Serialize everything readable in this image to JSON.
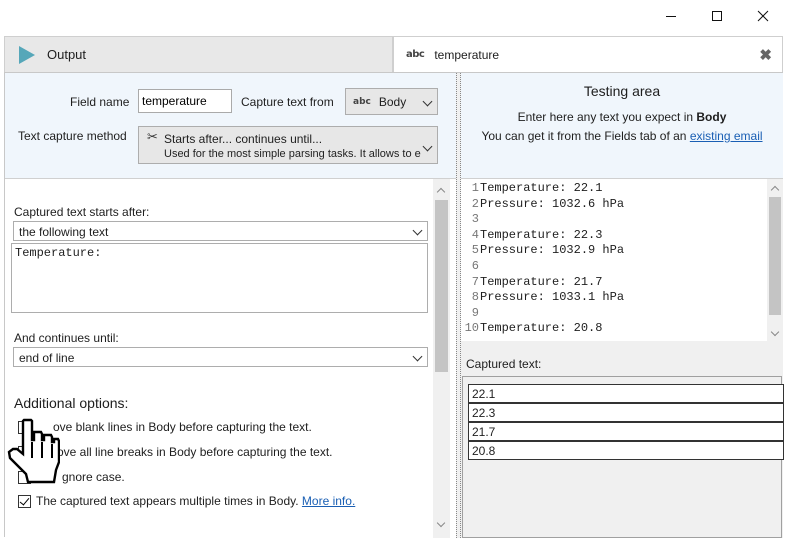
{
  "window": {
    "minimize_glyph": "—",
    "maximize_glyph": "☐",
    "close_glyph": "✕"
  },
  "tabs": [
    {
      "label": "Output",
      "icon": "play-icon"
    },
    {
      "label": "temperature",
      "icon": "abc-icon",
      "icon_text": "abc",
      "close_glyph": "✖"
    }
  ],
  "field_config": {
    "field_name_label": "Field name",
    "field_name_value": "temperature",
    "capture_from_label": "Capture text from",
    "capture_from_icon_text": "abc",
    "capture_from_value": "Body",
    "method_label": "Text capture method",
    "method_icon": "scissors-icon",
    "method_title": "Starts after... continues until...",
    "method_desc": "Used for the most simple parsing tasks. It allows to e"
  },
  "capture_rules": {
    "starts_after_label": "Captured text starts after:",
    "starts_after_mode": "the following text",
    "starts_after_text": "Temperature:",
    "continues_until_label": "And continues until:",
    "continues_until_mode": "end of line"
  },
  "additional_options": {
    "heading": "Additional options:",
    "options": [
      {
        "label": "Remove blank lines in Body before capturing the text.",
        "visible_label": "ove blank lines in Body before capturing the text.",
        "checked": false
      },
      {
        "label": "Remove all line breaks in Body before capturing the text.",
        "visible_label": "ove all line breaks in Body before capturing the text.",
        "checked": false
      },
      {
        "label": "Ignore case.",
        "visible_label": "gnore case.",
        "checked": false
      },
      {
        "label": "The captured text appears multiple times in Body.",
        "visible_label": "The captured text appears multiple times in Body.",
        "checked": true,
        "link": "More info."
      }
    ]
  },
  "testing_area": {
    "title": "Testing area",
    "line1_prefix": "Enter here any text you expect in ",
    "line1_bold": "Body",
    "line2_prefix": "You can get it from the Fields tab of an ",
    "line2_link": "existing email"
  },
  "test_lines": [
    {
      "n": "1",
      "text": "Temperature: 22.1"
    },
    {
      "n": "2",
      "text": "Pressure: 1032.6 hPa"
    },
    {
      "n": "3",
      "text": ""
    },
    {
      "n": "4",
      "text": "Temperature: 22.3"
    },
    {
      "n": "5",
      "text": "Pressure: 1032.9 hPa"
    },
    {
      "n": "6",
      "text": ""
    },
    {
      "n": "7",
      "text": "Temperature: 21.7"
    },
    {
      "n": "8",
      "text": "Pressure: 1033.1 hPa"
    },
    {
      "n": "9",
      "text": ""
    },
    {
      "n": "10",
      "text": "Temperature: 20.8"
    }
  ],
  "captured": {
    "label": "Captured text:",
    "values": [
      "22.1",
      "22.3",
      "21.7",
      "20.8"
    ]
  }
}
